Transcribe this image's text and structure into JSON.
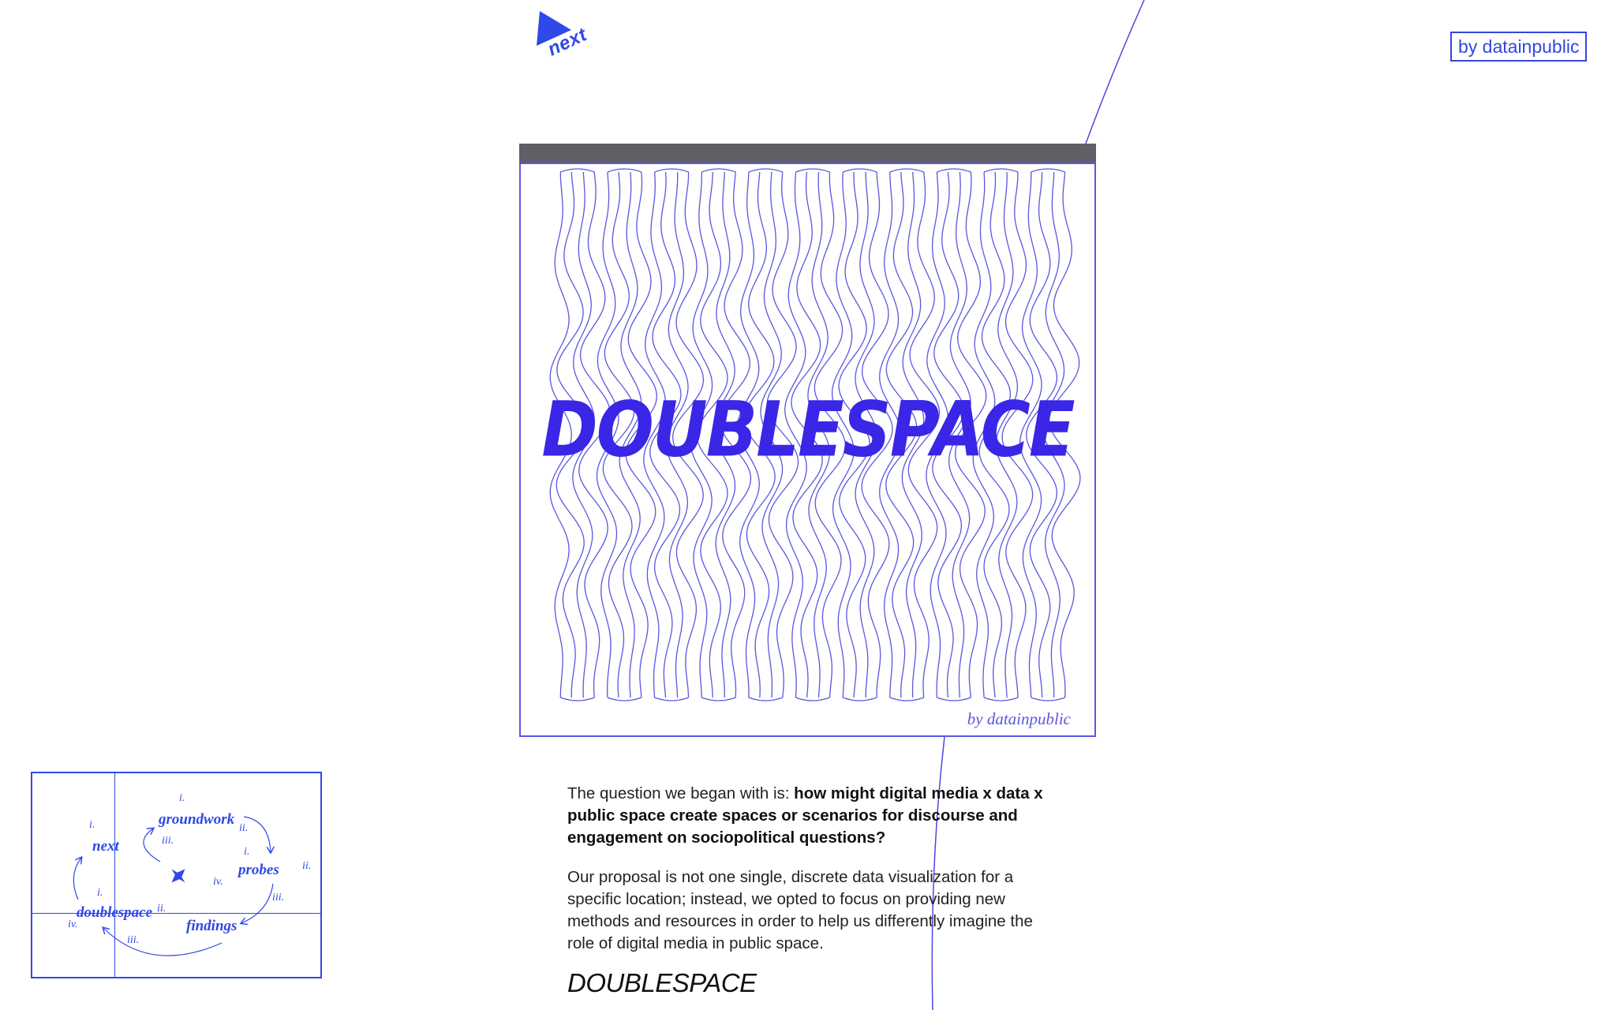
{
  "nav": {
    "next_label": "next"
  },
  "header": {
    "credit": "by datainpublic"
  },
  "hero": {
    "title": "DOUBLESPACE",
    "credit": "by datainpublic"
  },
  "content": {
    "intro_plain": "The question we began with is: ",
    "intro_bold": "how might digital media x data x public space create spaces or scenarios for discourse and engagement on sociopolitical questions?",
    "proposal": "Our proposal is not one single, discrete data visualization for a specific location; instead, we opted to focus on providing new methods and resources in order to help us differently imagine the role of digital media in public space.",
    "section_heading": "DOUBLESPACE"
  },
  "minimap": {
    "items": {
      "groundwork": "groundwork",
      "next": "next",
      "probes": "probes",
      "doublespace": "doublespace",
      "findings": "findings"
    },
    "numerals": {
      "groundwork_i": "i.",
      "groundwork_ii": "ii.",
      "groundwork_iii": "iii.",
      "next_i": "i.",
      "probes_i": "i.",
      "probes_ii": "ii.",
      "probes_iii": "iii.",
      "probes_iv": "iv.",
      "doublespace_i": "i.",
      "doublespace_ii": "ii.",
      "doublespace_iv": "iv.",
      "findings_iii": "iii."
    }
  },
  "colors": {
    "accent_blue": "#2f48e8",
    "title_blue": "#3a26e6",
    "outline_blue": "#5a57e0",
    "window_bar": "#625e66"
  }
}
